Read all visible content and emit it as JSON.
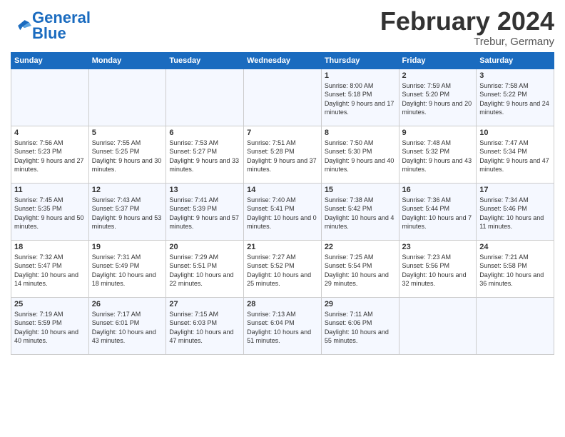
{
  "header": {
    "logo_text1": "General",
    "logo_text2": "Blue",
    "title": "February 2024",
    "subtitle": "Trebur, Germany"
  },
  "days_of_week": [
    "Sunday",
    "Monday",
    "Tuesday",
    "Wednesday",
    "Thursday",
    "Friday",
    "Saturday"
  ],
  "weeks": [
    [
      {
        "day": "",
        "info": ""
      },
      {
        "day": "",
        "info": ""
      },
      {
        "day": "",
        "info": ""
      },
      {
        "day": "",
        "info": ""
      },
      {
        "day": "1",
        "info": "Sunrise: 8:00 AM\nSunset: 5:18 PM\nDaylight: 9 hours\nand 17 minutes."
      },
      {
        "day": "2",
        "info": "Sunrise: 7:59 AM\nSunset: 5:20 PM\nDaylight: 9 hours\nand 20 minutes."
      },
      {
        "day": "3",
        "info": "Sunrise: 7:58 AM\nSunset: 5:22 PM\nDaylight: 9 hours\nand 24 minutes."
      }
    ],
    [
      {
        "day": "4",
        "info": "Sunrise: 7:56 AM\nSunset: 5:23 PM\nDaylight: 9 hours\nand 27 minutes."
      },
      {
        "day": "5",
        "info": "Sunrise: 7:55 AM\nSunset: 5:25 PM\nDaylight: 9 hours\nand 30 minutes."
      },
      {
        "day": "6",
        "info": "Sunrise: 7:53 AM\nSunset: 5:27 PM\nDaylight: 9 hours\nand 33 minutes."
      },
      {
        "day": "7",
        "info": "Sunrise: 7:51 AM\nSunset: 5:28 PM\nDaylight: 9 hours\nand 37 minutes."
      },
      {
        "day": "8",
        "info": "Sunrise: 7:50 AM\nSunset: 5:30 PM\nDaylight: 9 hours\nand 40 minutes."
      },
      {
        "day": "9",
        "info": "Sunrise: 7:48 AM\nSunset: 5:32 PM\nDaylight: 9 hours\nand 43 minutes."
      },
      {
        "day": "10",
        "info": "Sunrise: 7:47 AM\nSunset: 5:34 PM\nDaylight: 9 hours\nand 47 minutes."
      }
    ],
    [
      {
        "day": "11",
        "info": "Sunrise: 7:45 AM\nSunset: 5:35 PM\nDaylight: 9 hours\nand 50 minutes."
      },
      {
        "day": "12",
        "info": "Sunrise: 7:43 AM\nSunset: 5:37 PM\nDaylight: 9 hours\nand 53 minutes."
      },
      {
        "day": "13",
        "info": "Sunrise: 7:41 AM\nSunset: 5:39 PM\nDaylight: 9 hours\nand 57 minutes."
      },
      {
        "day": "14",
        "info": "Sunrise: 7:40 AM\nSunset: 5:41 PM\nDaylight: 10 hours\nand 0 minutes."
      },
      {
        "day": "15",
        "info": "Sunrise: 7:38 AM\nSunset: 5:42 PM\nDaylight: 10 hours\nand 4 minutes."
      },
      {
        "day": "16",
        "info": "Sunrise: 7:36 AM\nSunset: 5:44 PM\nDaylight: 10 hours\nand 7 minutes."
      },
      {
        "day": "17",
        "info": "Sunrise: 7:34 AM\nSunset: 5:46 PM\nDaylight: 10 hours\nand 11 minutes."
      }
    ],
    [
      {
        "day": "18",
        "info": "Sunrise: 7:32 AM\nSunset: 5:47 PM\nDaylight: 10 hours\nand 14 minutes."
      },
      {
        "day": "19",
        "info": "Sunrise: 7:31 AM\nSunset: 5:49 PM\nDaylight: 10 hours\nand 18 minutes."
      },
      {
        "day": "20",
        "info": "Sunrise: 7:29 AM\nSunset: 5:51 PM\nDaylight: 10 hours\nand 22 minutes."
      },
      {
        "day": "21",
        "info": "Sunrise: 7:27 AM\nSunset: 5:52 PM\nDaylight: 10 hours\nand 25 minutes."
      },
      {
        "day": "22",
        "info": "Sunrise: 7:25 AM\nSunset: 5:54 PM\nDaylight: 10 hours\nand 29 minutes."
      },
      {
        "day": "23",
        "info": "Sunrise: 7:23 AM\nSunset: 5:56 PM\nDaylight: 10 hours\nand 32 minutes."
      },
      {
        "day": "24",
        "info": "Sunrise: 7:21 AM\nSunset: 5:58 PM\nDaylight: 10 hours\nand 36 minutes."
      }
    ],
    [
      {
        "day": "25",
        "info": "Sunrise: 7:19 AM\nSunset: 5:59 PM\nDaylight: 10 hours\nand 40 minutes."
      },
      {
        "day": "26",
        "info": "Sunrise: 7:17 AM\nSunset: 6:01 PM\nDaylight: 10 hours\nand 43 minutes."
      },
      {
        "day": "27",
        "info": "Sunrise: 7:15 AM\nSunset: 6:03 PM\nDaylight: 10 hours\nand 47 minutes."
      },
      {
        "day": "28",
        "info": "Sunrise: 7:13 AM\nSunset: 6:04 PM\nDaylight: 10 hours\nand 51 minutes."
      },
      {
        "day": "29",
        "info": "Sunrise: 7:11 AM\nSunset: 6:06 PM\nDaylight: 10 hours\nand 55 minutes."
      },
      {
        "day": "",
        "info": ""
      },
      {
        "day": "",
        "info": ""
      }
    ]
  ]
}
